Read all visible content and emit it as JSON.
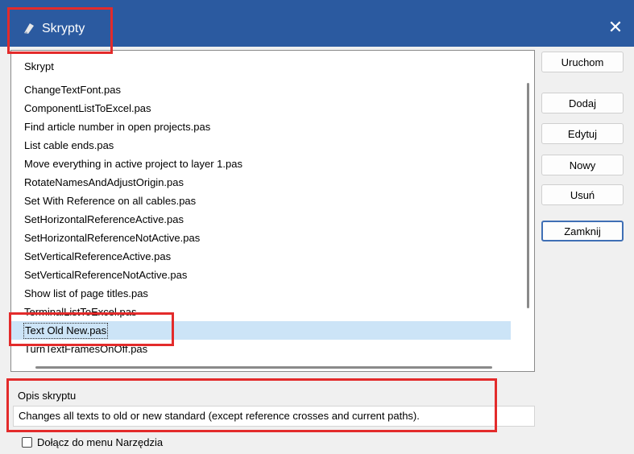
{
  "window": {
    "title": "Skrypty",
    "close_glyph": "✕"
  },
  "list": {
    "header": "Skrypt",
    "items": [
      "ChangeTextFont.pas",
      "ComponentListToExcel.pas",
      "Find article number in open projects.pas",
      "List cable ends.pas",
      "Move everything in active project to layer 1.pas",
      "RotateNamesAndAdjustOrigin.pas",
      "Set With Reference on all cables.pas",
      "SetHorizontalReferenceActive.pas",
      "SetHorizontalReferenceNotActive.pas",
      "SetVerticalReferenceActive.pas",
      "SetVerticalReferenceNotActive.pas",
      "Show list of page titles.pas",
      "TerminalListToExcel.pas",
      "Text Old New.pas",
      "TurnTextFramesOnOff.pas"
    ],
    "selected_index": 13
  },
  "buttons": {
    "run": "Uruchom",
    "add": "Dodaj",
    "edit": "Edytuj",
    "new": "Nowy",
    "delete": "Usuń",
    "close": "Zamknij"
  },
  "description": {
    "label": "Opis skryptu",
    "text": "Changes all texts to old or new standard (except reference crosses and current paths)."
  },
  "tools_menu": {
    "label": "Dołącz do menu Narzędzia",
    "checked": false
  },
  "colors": {
    "titlebar": "#2b5aa0",
    "highlight": "#e32b2b",
    "selection": "#cce4f7"
  }
}
